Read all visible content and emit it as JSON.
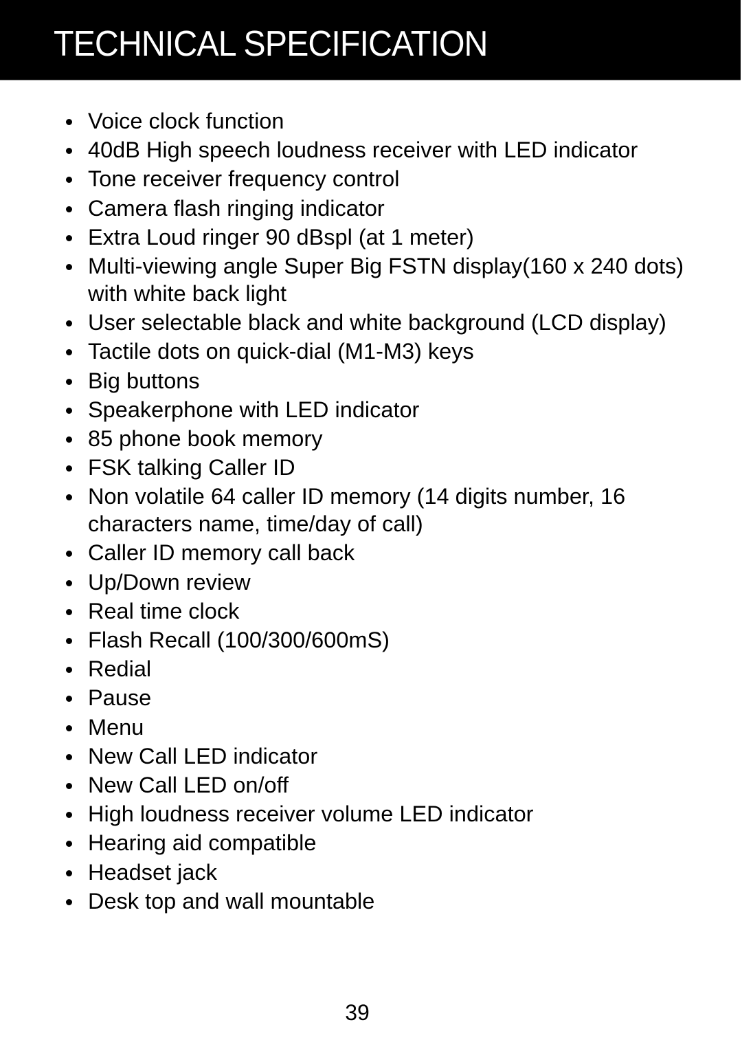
{
  "header": {
    "title": "TECHNICAL SPECIFICATION",
    "background_color": "#000000",
    "text_color": "#ffffff"
  },
  "spec_list": {
    "items": [
      "Voice clock function",
      "40dB High speech loudness receiver with LED indicator",
      "Tone receiver frequency control",
      "Camera flash ringing indicator",
      "Extra Loud ringer 90 dBspl (at 1 meter)",
      "Multi-viewing angle Super Big FSTN display(160 x 240 dots) with white back light",
      "User selectable black and white background (LCD display)",
      "Tactile dots on quick-dial (M1-M3) keys",
      "Big buttons",
      "Speakerphone with LED indicator",
      "85 phone book memory",
      "FSK talking Caller ID",
      "Non volatile 64 caller ID memory (14 digits number, 16 characters name, time/day of call)",
      "Caller ID memory call back",
      "Up/Down review",
      "Real time clock",
      "Flash Recall (100/300/600mS)",
      "Redial",
      "Pause",
      "Menu",
      "New Call LED indicator",
      "New Call LED on/off",
      "High loudness receiver volume LED indicator",
      "Hearing aid compatible",
      "Headset jack",
      "Desk top and wall mountable"
    ]
  },
  "footer": {
    "page_number": "39"
  }
}
